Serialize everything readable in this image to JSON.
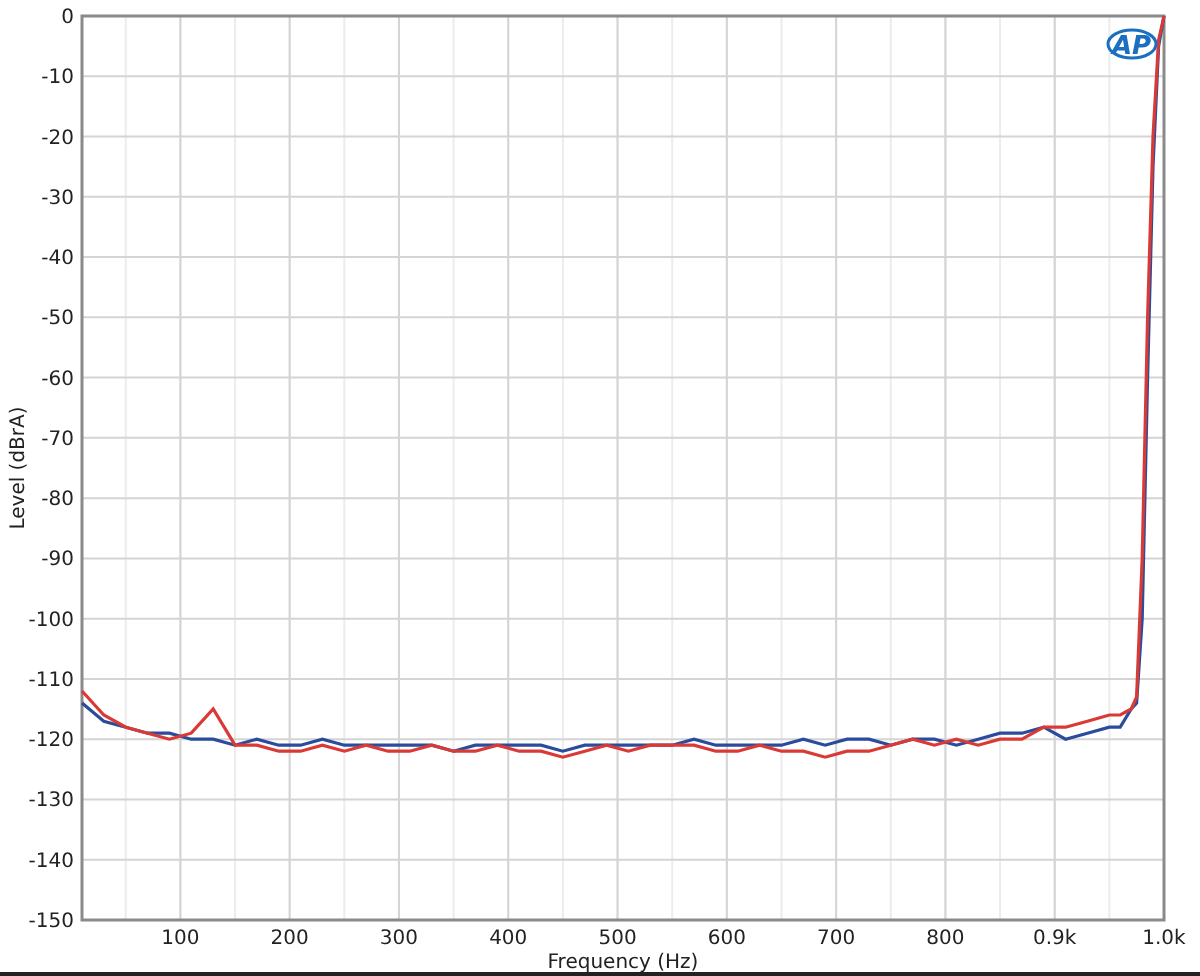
{
  "logo": "AP",
  "chart_data": {
    "type": "line",
    "grid": true,
    "xlabel": "Frequency (Hz)",
    "ylabel": "Level (dBrA)",
    "xlim": [
      10,
      1000
    ],
    "ylim": [
      -150,
      0
    ],
    "xticks": [
      100,
      200,
      300,
      400,
      500,
      600,
      700,
      800,
      {
        "value": 900,
        "label": "0.9k"
      },
      {
        "value": 1000,
        "label": "1.0k"
      }
    ],
    "yticks": [
      0,
      -10,
      -20,
      -30,
      -40,
      -50,
      -60,
      -70,
      -80,
      -90,
      -100,
      -110,
      -120,
      -130,
      -140,
      -150
    ],
    "x": [
      10,
      30,
      50,
      70,
      90,
      110,
      130,
      150,
      170,
      190,
      210,
      230,
      250,
      270,
      290,
      310,
      330,
      350,
      370,
      390,
      410,
      430,
      450,
      470,
      490,
      510,
      530,
      550,
      570,
      590,
      610,
      630,
      650,
      670,
      690,
      710,
      730,
      750,
      770,
      790,
      810,
      830,
      850,
      870,
      890,
      910,
      930,
      950,
      960,
      970,
      975,
      980,
      985,
      990,
      995,
      1000
    ],
    "series": [
      {
        "color": "#2b4c9c",
        "values": [
          -114,
          -117,
          -118,
          -119,
          -119,
          -120,
          -120,
          -121,
          -120,
          -121,
          -121,
          -120,
          -121,
          -121,
          -121,
          -121,
          -121,
          -122,
          -121,
          -121,
          -121,
          -121,
          -122,
          -121,
          -121,
          -121,
          -121,
          -121,
          -120,
          -121,
          -121,
          -121,
          -121,
          -120,
          -121,
          -120,
          -120,
          -121,
          -120,
          -120,
          -121,
          -120,
          -119,
          -119,
          -118,
          -120,
          -119,
          -118,
          -118,
          -115,
          -114,
          -100,
          -60,
          -25,
          -5,
          0
        ]
      },
      {
        "color": "#d93a36",
        "values": [
          -112,
          -116,
          -118,
          -119,
          -120,
          -119,
          -115,
          -121,
          -121,
          -122,
          -122,
          -121,
          -122,
          -121,
          -122,
          -122,
          -121,
          -122,
          -122,
          -121,
          -122,
          -122,
          -123,
          -122,
          -121,
          -122,
          -121,
          -121,
          -121,
          -122,
          -122,
          -121,
          -122,
          -122,
          -123,
          -122,
          -122,
          -121,
          -120,
          -121,
          -120,
          -121,
          -120,
          -120,
          -118,
          -118,
          -117,
          -116,
          -116,
          -115,
          -113,
          -90,
          -50,
          -20,
          -4,
          0
        ]
      }
    ]
  }
}
